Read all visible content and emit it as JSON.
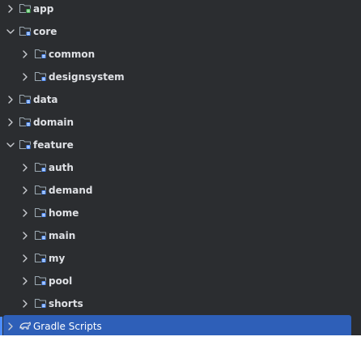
{
  "colors": {
    "background": "#2b2d30",
    "text": "#dfe1e5",
    "selection": "#2e5fb8",
    "folder_outline": "#9aa7b0",
    "module_badge": "#4d8dff",
    "app_badge": "#3fb950"
  },
  "tree": [
    {
      "label": "app",
      "icon": "app-module-folder-icon",
      "expanded": false,
      "depth": 0
    },
    {
      "label": "core",
      "icon": "module-folder-icon",
      "expanded": true,
      "depth": 0
    },
    {
      "label": "common",
      "icon": "module-folder-icon",
      "expanded": false,
      "depth": 1
    },
    {
      "label": "designsystem",
      "icon": "module-folder-icon",
      "expanded": false,
      "depth": 1
    },
    {
      "label": "data",
      "icon": "module-folder-icon",
      "expanded": false,
      "depth": 0
    },
    {
      "label": "domain",
      "icon": "module-folder-icon",
      "expanded": false,
      "depth": 0
    },
    {
      "label": "feature",
      "icon": "module-folder-icon",
      "expanded": true,
      "depth": 0
    },
    {
      "label": "auth",
      "icon": "module-folder-icon",
      "expanded": false,
      "depth": 1
    },
    {
      "label": "demand",
      "icon": "module-folder-icon",
      "expanded": false,
      "depth": 1
    },
    {
      "label": "home",
      "icon": "module-folder-icon",
      "expanded": false,
      "depth": 1
    },
    {
      "label": "main",
      "icon": "module-folder-icon",
      "expanded": false,
      "depth": 1
    },
    {
      "label": "my",
      "icon": "module-folder-icon",
      "expanded": false,
      "depth": 1
    },
    {
      "label": "pool",
      "icon": "module-folder-icon",
      "expanded": false,
      "depth": 1
    },
    {
      "label": "shorts",
      "icon": "module-folder-icon",
      "expanded": false,
      "depth": 1
    },
    {
      "label": "Gradle Scripts",
      "icon": "gradle-elephant-icon",
      "expanded": false,
      "depth": 0,
      "selected": true
    }
  ]
}
